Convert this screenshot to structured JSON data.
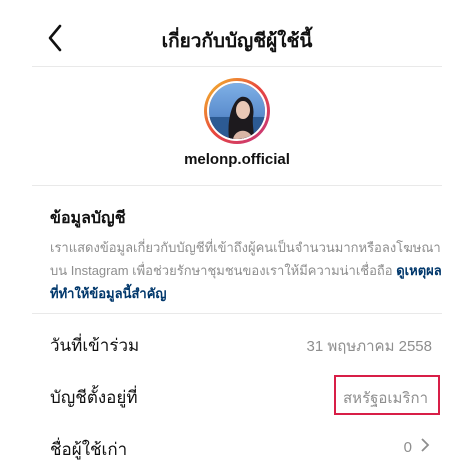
{
  "header": {
    "title": "เกี่ยวกับบัญชีผู้ใช้นี้",
    "back_icon": "chevron-left-icon"
  },
  "profile": {
    "username": "melonp.official"
  },
  "account_info": {
    "title": "ข้อมูลบัญชี",
    "description": "เราแสดงข้อมูลเกี่ยวกับบัญชีที่เข้าถึงผู้คนเป็นจำนวนมากหรือลงโฆษณาบน Instagram เพื่อช่วยรักษาชุมชนของเราให้มีความน่าเชื่อถือ",
    "link": "ดูเหตุผลที่ทำให้ข้อมูลนี้สำคัญ"
  },
  "rows": [
    {
      "label": "วันที่เข้าร่วม",
      "value": "31 พฤษภาคม 2558"
    },
    {
      "label": "บัญชีตั้งอยู่ที่",
      "value": "สหรัฐอเมริกา"
    },
    {
      "label": "ชื่อผู้ใช้เก่า",
      "value": "0"
    }
  ],
  "colors": {
    "highlight": "#d81e47",
    "link": "#00376b",
    "muted": "#8e8e8e"
  }
}
